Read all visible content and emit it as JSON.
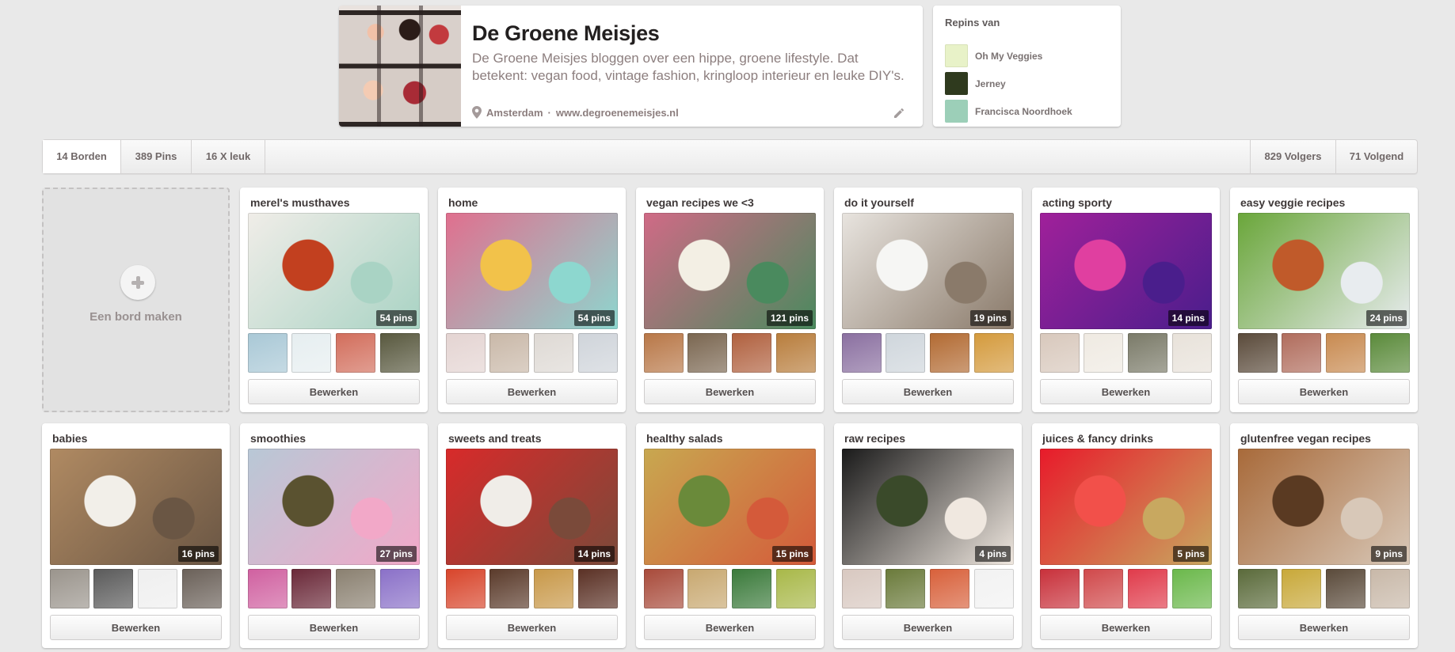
{
  "profile": {
    "name": "De Groene Meisjes",
    "description": "De Groene Meisjes bloggen over een hippe, groene lifestyle. Dat betekent: vegan food, vintage fashion, kringloop interieur en leuke DIY's.",
    "location": "Amsterdam",
    "separator": "·",
    "website": "www.degroenemeisjes.nl"
  },
  "repins": {
    "title": "Repins van",
    "items": [
      {
        "name": "Oh My Veggies",
        "color": "#e8f2c8"
      },
      {
        "name": "Jerney",
        "color": "#2f3a1e"
      },
      {
        "name": "Francisca Noordhoek",
        "color": "#9ccfb8"
      }
    ]
  },
  "stats": {
    "boards": "14 Borden",
    "pins": "389 Pins",
    "likes": "16 X leuk",
    "followers": "829 Volgers",
    "following": "71 Volgend"
  },
  "create_board": {
    "label": "Een bord maken"
  },
  "edit_label": "Bewerken",
  "boards": [
    {
      "title": "merel's musthaves",
      "count": "54 pins",
      "cover": [
        "#f0ede8",
        "#c2401f",
        "#a9d3c4"
      ],
      "thumbs": [
        "#a9c8d6",
        "#e6eef0",
        "#d26d5b",
        "#58583e"
      ]
    },
    {
      "title": "home",
      "count": "54 pins",
      "cover": [
        "#e06f8e",
        "#f2c24a",
        "#8dd7cf"
      ],
      "thumbs": [
        "#e4d4d2",
        "#c9b8a8",
        "#ded9d4",
        "#cfd4da"
      ]
    },
    {
      "title": "vegan recipes we <3",
      "count": "121 pins",
      "cover": [
        "#d06a86",
        "#f3efe4",
        "#4a8a5e"
      ],
      "thumbs": [
        "#b87747",
        "#7a6650",
        "#b0603e",
        "#b87d3c"
      ]
    },
    {
      "title": "do it yourself",
      "count": "19 pins",
      "cover": [
        "#e8e4df",
        "#f6f6f4",
        "#8a7a6a"
      ],
      "thumbs": [
        "#8a6fa0",
        "#cfd6dc",
        "#b26a32",
        "#d49a3c"
      ]
    },
    {
      "title": "acting sporty",
      "count": "14 pins",
      "cover": [
        "#a0209a",
        "#e03fa0",
        "#4a1e8c"
      ],
      "thumbs": [
        "#d8c8bc",
        "#efeae2",
        "#7a7a68",
        "#e8e2da"
      ]
    },
    {
      "title": "easy veggie recipes",
      "count": "24 pins",
      "cover": [
        "#6aa63a",
        "#c05a2a",
        "#e8ecef"
      ],
      "thumbs": [
        "#5a4a3a",
        "#b06c5c",
        "#c88a50",
        "#5a8a3a"
      ]
    },
    {
      "title": "babies",
      "count": "16 pins",
      "cover": [
        "#b08a62",
        "#f2efe9",
        "#6a5644"
      ],
      "thumbs": [
        "#9a948c",
        "#5a5a5a",
        "#efefef",
        "#6a6058"
      ]
    },
    {
      "title": "smoothies",
      "count": "27 pins",
      "cover": [
        "#b8c8d6",
        "#5a5230",
        "#f2a8c8"
      ],
      "thumbs": [
        "#d060a0",
        "#6a2838",
        "#8a8070",
        "#8a70c8"
      ]
    },
    {
      "title": "sweets and treats",
      "count": "14 pins",
      "cover": [
        "#d82a2a",
        "#f0ede8",
        "#7a4a3a"
      ],
      "thumbs": [
        "#d8442a",
        "#5a3a2a",
        "#c89848",
        "#5a3024"
      ]
    },
    {
      "title": "healthy salads",
      "count": "15 pins",
      "cover": [
        "#c8a850",
        "#6a8a3a",
        "#d45a3a"
      ],
      "thumbs": [
        "#a84a3a",
        "#c8a870",
        "#3a7a3a",
        "#a8b848"
      ]
    },
    {
      "title": "raw recipes",
      "count": "4 pins",
      "cover": [
        "#1a1a1a",
        "#3a4a2a",
        "#f0e8e0"
      ],
      "thumbs": [
        "#d8c8c0",
        "#6a7a3a",
        "#d8603a",
        "#f2f2f2"
      ]
    },
    {
      "title": "juices & fancy drinks",
      "count": "5 pins",
      "cover": [
        "#e81a2a",
        "#f2504a",
        "#c8a860"
      ],
      "thumbs": [
        "#c8303a",
        "#d0484a",
        "#e03a4a",
        "#6ab84a"
      ]
    },
    {
      "title": "glutenfree vegan recipes",
      "count": "9 pins",
      "cover": [
        "#a86a3a",
        "#5a3a22",
        "#d8c8b8"
      ],
      "thumbs": [
        "#5a6a3a",
        "#c8a838",
        "#5a4a3a",
        "#c8b8a8"
      ]
    }
  ]
}
